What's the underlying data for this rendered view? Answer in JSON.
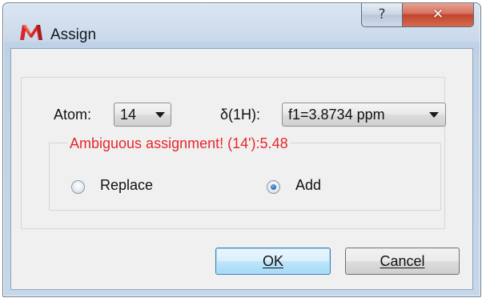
{
  "window": {
    "title": "Assign",
    "help_glyph": "?",
    "close_glyph": "✕"
  },
  "atom": {
    "label": "Atom:",
    "value": "14"
  },
  "shift": {
    "label": "δ(1H):",
    "value": "f1=3.8734 ppm"
  },
  "warning": "Ambiguous assignment! (14'):5.48",
  "options": {
    "replace_label": "Replace",
    "add_label": "Add",
    "selected": "Add"
  },
  "buttons": {
    "ok_label": "OK",
    "cancel_label": "Cancel"
  },
  "icons": {
    "app_logo": "mnova-logo-icon",
    "help": "help-icon",
    "close": "close-icon"
  },
  "colors": {
    "warning_text": "#e8262a",
    "close_button": "#c2452e",
    "logo_red": "#d6262b",
    "radio_selected": "#2b6fb8"
  }
}
